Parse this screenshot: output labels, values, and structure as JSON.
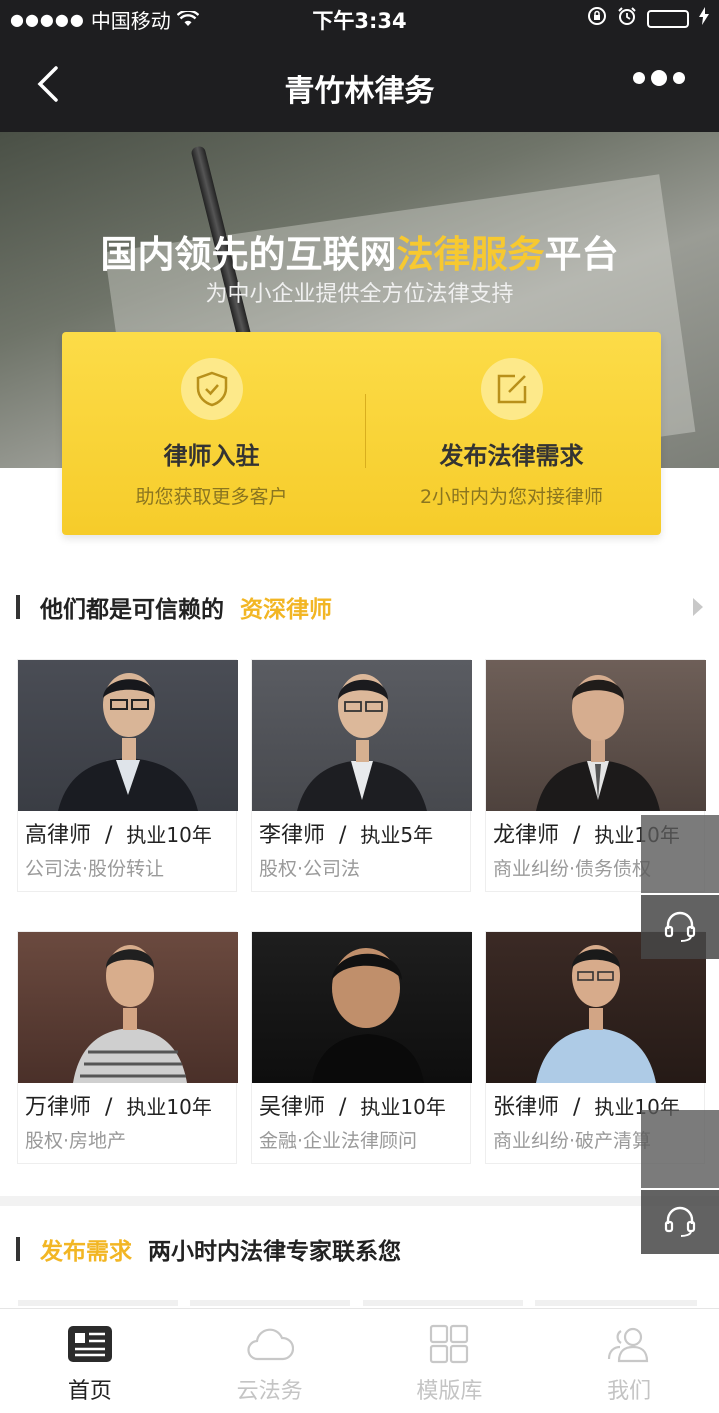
{
  "status_bar": {
    "signal": "●●●●●",
    "carrier": "中国移动",
    "time": "下午3:34"
  },
  "nav": {
    "title": "青竹林律务"
  },
  "hero": {
    "title_part1": "国内领先的互联网",
    "title_highlight": "法律服务",
    "title_part2": "平台",
    "subtitle": "为中小企业提供全方位法律支持"
  },
  "actions": [
    {
      "title": "律师入驻",
      "subtitle": "助您获取更多客户",
      "icon": "shield-check-icon"
    },
    {
      "title": "发布法律需求",
      "subtitle": "2小时内为您对接律师",
      "icon": "edit-icon"
    }
  ],
  "lawyers_section": {
    "title_plain": "他们都是可信赖的",
    "title_highlight": "资深律师"
  },
  "lawyers": [
    {
      "name": "高律师",
      "experience": "执业10年",
      "specialty": "公司法·股份转让"
    },
    {
      "name": "李律师",
      "experience": "执业5年",
      "specialty": "股权·公司法"
    },
    {
      "name": "龙律师",
      "experience": "执业10年",
      "specialty": "商业纠纷·债务债权"
    },
    {
      "name": "万律师",
      "experience": "执业10年",
      "specialty": "股权·房地产"
    },
    {
      "name": "吴律师",
      "experience": "执业10年",
      "specialty": "金融·企业法律顾问"
    },
    {
      "name": "张律师",
      "experience": "执业10年",
      "specialty": "商业纠纷·破产清算"
    }
  ],
  "request_section": {
    "title_highlight": "发布需求",
    "title_plain": "两小时内法律专家联系您"
  },
  "tabs": [
    {
      "label": "首页",
      "icon": "news-icon",
      "active": true
    },
    {
      "label": "云法务",
      "icon": "cloud-icon",
      "active": false
    },
    {
      "label": "模版库",
      "icon": "grid-icon",
      "active": false
    },
    {
      "label": "我们",
      "icon": "people-icon",
      "active": false
    }
  ],
  "colors": {
    "accent": "#f7c930",
    "nav_bg": "#1e1e20",
    "highlight_text": "#f2b624"
  }
}
